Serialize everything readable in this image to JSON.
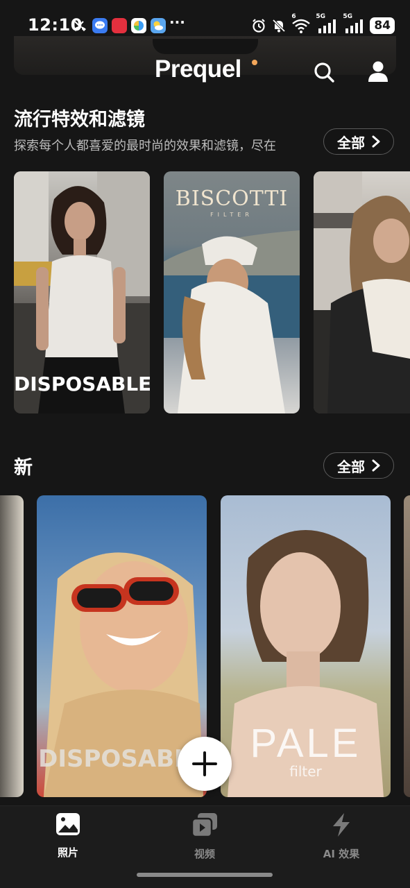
{
  "status_bar": {
    "time": "12:10",
    "extra_dots": "···",
    "network_1": "5G",
    "network_2": "5G",
    "wifi_badge": "6",
    "battery": "84",
    "notification_icons": [
      "missed-call-icon",
      "messages-app-icon",
      "xiaohongshu-app-icon",
      "browser-app-icon",
      "weather-app-icon"
    ]
  },
  "header": {
    "logo": "Prequel",
    "accent_color": "#f2a65a"
  },
  "trending": {
    "title": "流行特效和滤镜",
    "subtitle": "探索每个人都喜爱的最时尚的效果和滤镜，尽在",
    "all_label": "全部",
    "cards": [
      {
        "label": "DISPOSABLE"
      },
      {
        "title": "BISCOTTI",
        "subtitle": "FILTER"
      },
      {
        "label": ""
      }
    ]
  },
  "new": {
    "title": "新",
    "all_label": "全部",
    "cards": [
      {
        "label": ""
      },
      {
        "label": "DISPOSABLE"
      },
      {
        "title": "PALE",
        "subtitle": "filter"
      },
      {
        "label": ""
      }
    ]
  },
  "fab": {
    "icon": "plus-icon"
  },
  "bottom_nav": {
    "items": [
      {
        "label": "照片",
        "icon": "photo-icon",
        "active": true
      },
      {
        "label": "视频",
        "icon": "video-icon",
        "active": false
      },
      {
        "label": "AI 效果",
        "icon": "lightning-icon",
        "active": false
      }
    ]
  }
}
